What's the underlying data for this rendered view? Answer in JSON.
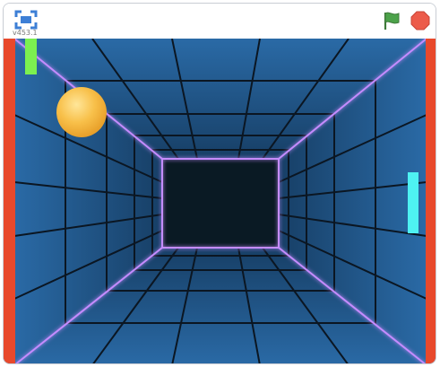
{
  "header": {
    "version": "v453.1",
    "fullscreen_icon": "fullscreen-icon",
    "flag_icon": "green-flag-icon",
    "stop_icon": "stop-icon"
  },
  "stage": {
    "colors": {
      "tunnel_blue": "#1e5c92",
      "tunnel_dark": "#0a1a24",
      "grid_line": "#0b1622",
      "neon_edge": "#c58cff",
      "wall_red": "#e8492c",
      "left_paddle": "#7cf050",
      "right_paddle": "#4ef2f2",
      "ball_orange": "#f4b23b"
    }
  }
}
